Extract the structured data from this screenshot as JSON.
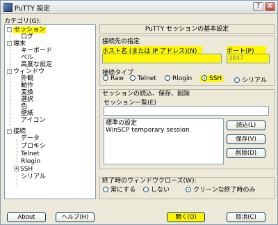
{
  "window": {
    "title": "PuTTY 設定",
    "help_glyph": "?",
    "close_glyph": "X"
  },
  "category_label": "カテゴリ(G):",
  "tree": [
    {
      "label": "セッション",
      "indent": 0,
      "expander": "-",
      "selected": true
    },
    {
      "label": "ログ",
      "indent": 1
    },
    {
      "label": "端末",
      "indent": 0,
      "expander": "-"
    },
    {
      "label": "キーボード",
      "indent": 1
    },
    {
      "label": "ベル",
      "indent": 1
    },
    {
      "label": "高度な設定",
      "indent": 1
    },
    {
      "label": "ウィンドウ",
      "indent": 0,
      "expander": "-"
    },
    {
      "label": "外観",
      "indent": 1
    },
    {
      "label": "動作",
      "indent": 1
    },
    {
      "label": "変換",
      "indent": 1
    },
    {
      "label": "選択",
      "indent": 1
    },
    {
      "label": "色",
      "indent": 1
    },
    {
      "label": "壁紙",
      "indent": 1
    },
    {
      "label": "アイコン",
      "indent": 1
    },
    {
      "label": "接続",
      "indent": 0,
      "expander": "-"
    },
    {
      "label": "データ",
      "indent": 1
    },
    {
      "label": "プロキシ",
      "indent": 1
    },
    {
      "label": "Telnet",
      "indent": 1
    },
    {
      "label": "Rlogin",
      "indent": 1
    },
    {
      "label": "SSH",
      "indent": 1,
      "expander": "+"
    },
    {
      "label": "シリアル",
      "indent": 1
    }
  ],
  "panel_title": "PuTTY セッションの基本設定",
  "dest_group": "接続先の指定",
  "host_label": "ホスト名 (または IP アドレス)(N)",
  "host_value": "",
  "port_label": "ポート(P)",
  "port_value": "3847",
  "conn_type_label": "接続タイプ",
  "conn_types": [
    {
      "label": "Raw",
      "checked": false
    },
    {
      "label": "Telnet",
      "checked": false
    },
    {
      "label": "Rlogin",
      "checked": false
    },
    {
      "label": "SSH",
      "checked": true
    },
    {
      "label": "シリアル",
      "checked": false
    }
  ],
  "sessions_group": "セッションの読込、保存、削除",
  "sessions_label": "セッション一覧(E)",
  "session_name_value": "",
  "sessions": [
    "標準の設定",
    "WinSCP temporary session"
  ],
  "btn_load": "読込(L)",
  "btn_save": "保存(V)",
  "btn_delete": "削除(D)",
  "close_group": "終了時のウィンドウクローズ(W):",
  "close_options": [
    {
      "label": "常にする",
      "checked": false
    },
    {
      "label": "しない",
      "checked": false
    },
    {
      "label": "クリーンな終了時のみ",
      "checked": true
    }
  ],
  "btn_about": "About",
  "btn_help": "ヘルプ(H)",
  "btn_open": "開く(O)",
  "btn_cancel": "取消(C)",
  "colors": {
    "highlight": "#fff500",
    "accent": "#21a121"
  }
}
